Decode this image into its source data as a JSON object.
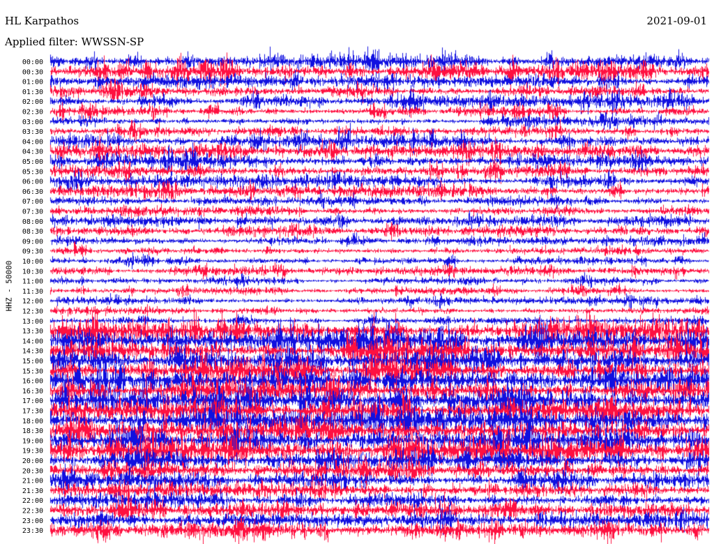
{
  "header": {
    "station": "HL Karpathos",
    "filter_label": "Applied filter: WWSSN-SP",
    "date": "2021-09-01"
  },
  "chart_data": {
    "type": "line",
    "title": "HL Karpathos",
    "subtitle": "Applied filter: WWSSN-SP",
    "date": "2021-09-01",
    "ylabel": "HHZ - 50000",
    "xlabel": "",
    "colors": [
      "#1010e0",
      "#ff1040"
    ],
    "rows": [
      {
        "label": "00:00",
        "color": "blue",
        "level": 0.55
      },
      {
        "label": "00:30",
        "color": "red",
        "level": 0.7
      },
      {
        "label": "01:00",
        "color": "blue",
        "level": 0.5
      },
      {
        "label": "01:30",
        "color": "red",
        "level": 0.45
      },
      {
        "label": "02:00",
        "color": "blue",
        "level": 0.45
      },
      {
        "label": "02:30",
        "color": "red",
        "level": 0.3
      },
      {
        "label": "03:00",
        "color": "blue",
        "level": 0.3
      },
      {
        "label": "03:30",
        "color": "red",
        "level": 0.35
      },
      {
        "label": "04:00",
        "color": "blue",
        "level": 0.45
      },
      {
        "label": "04:30",
        "color": "red",
        "level": 0.5
      },
      {
        "label": "05:00",
        "color": "blue",
        "level": 0.55
      },
      {
        "label": "05:30",
        "color": "red",
        "level": 0.4
      },
      {
        "label": "06:00",
        "color": "blue",
        "level": 0.4
      },
      {
        "label": "06:30",
        "color": "red",
        "level": 0.45
      },
      {
        "label": "07:00",
        "color": "blue",
        "level": 0.3
      },
      {
        "label": "07:30",
        "color": "red",
        "level": 0.35
      },
      {
        "label": "08:00",
        "color": "blue",
        "level": 0.4
      },
      {
        "label": "08:30",
        "color": "red",
        "level": 0.35
      },
      {
        "label": "09:00",
        "color": "blue",
        "level": 0.25
      },
      {
        "label": "09:30",
        "color": "red",
        "level": 0.25
      },
      {
        "label": "10:00",
        "color": "blue",
        "level": 0.2
      },
      {
        "label": "10:30",
        "color": "red",
        "level": 0.25
      },
      {
        "label": "11:00",
        "color": "blue",
        "level": 0.2
      },
      {
        "label": "11:30",
        "color": "red",
        "level": 0.2
      },
      {
        "label": "12:00",
        "color": "blue",
        "level": 0.2
      },
      {
        "label": "12:30",
        "color": "red",
        "level": 0.2
      },
      {
        "label": "13:00",
        "color": "blue",
        "level": 0.15
      },
      {
        "label": "13:30",
        "color": "red",
        "level": 1.0
      },
      {
        "label": "14:00",
        "color": "blue",
        "level": 1.0
      },
      {
        "label": "14:30",
        "color": "red",
        "level": 1.0
      },
      {
        "label": "15:00",
        "color": "blue",
        "level": 1.0
      },
      {
        "label": "15:30",
        "color": "red",
        "level": 1.0
      },
      {
        "label": "16:00",
        "color": "blue",
        "level": 1.0
      },
      {
        "label": "16:30",
        "color": "red",
        "level": 0.9
      },
      {
        "label": "17:00",
        "color": "blue",
        "level": 0.9
      },
      {
        "label": "17:30",
        "color": "red",
        "level": 0.95
      },
      {
        "label": "18:00",
        "color": "blue",
        "level": 1.0
      },
      {
        "label": "18:30",
        "color": "red",
        "level": 1.0
      },
      {
        "label": "19:00",
        "color": "blue",
        "level": 1.0
      },
      {
        "label": "19:30",
        "color": "red",
        "level": 1.0
      },
      {
        "label": "20:00",
        "color": "blue",
        "level": 0.8
      },
      {
        "label": "20:30",
        "color": "red",
        "level": 0.8
      },
      {
        "label": "21:00",
        "color": "blue",
        "level": 0.6
      },
      {
        "label": "21:30",
        "color": "red",
        "level": 0.55
      },
      {
        "label": "22:00",
        "color": "blue",
        "level": 0.55
      },
      {
        "label": "22:30",
        "color": "red",
        "level": 0.6
      },
      {
        "label": "23:00",
        "color": "blue",
        "level": 0.55
      },
      {
        "label": "23:30",
        "color": "red",
        "level": 0.6
      }
    ]
  }
}
